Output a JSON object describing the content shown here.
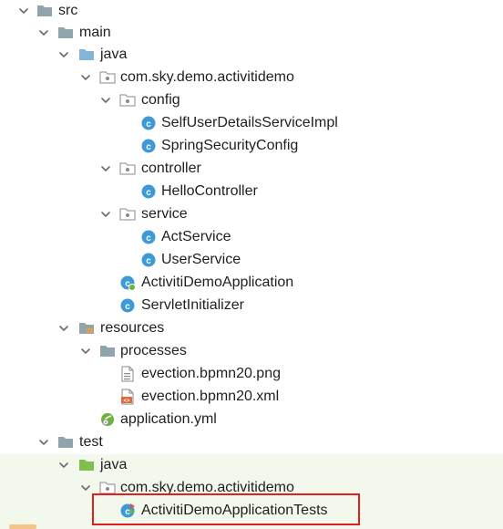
{
  "tree": {
    "src": "src",
    "main": "main",
    "main_java": "java",
    "main_package": "com.sky.demo.activitidemo",
    "config": "config",
    "self_user_details_service_impl": "SelfUserDetailsServiceImpl",
    "spring_security_config": "SpringSecurityConfig",
    "controller": "controller",
    "hello_controller": "HelloController",
    "service": "service",
    "act_service": "ActService",
    "user_service": "UserService",
    "activiti_demo_application": "ActivitiDemoApplication",
    "servlet_initializer": "ServletInitializer",
    "resources": "resources",
    "processes": "processes",
    "evection_png": "evection.bpmn20.png",
    "evection_xml": "evection.bpmn20.xml",
    "application_yml": "application.yml",
    "test": "test",
    "test_java": "java",
    "test_package": "com.sky.demo.activitidemo",
    "activiti_demo_application_tests": "ActivitiDemoApplicationTests"
  },
  "colors": {
    "folder": "#90a4ae",
    "source_folder": "#82b6d9",
    "test_source_folder": "#7fbf4e",
    "resources_folder": "#90a4ae",
    "class_icon": "#3d9ad6",
    "test_background": "#f2f8ec",
    "highlight_border": "#e02020"
  }
}
